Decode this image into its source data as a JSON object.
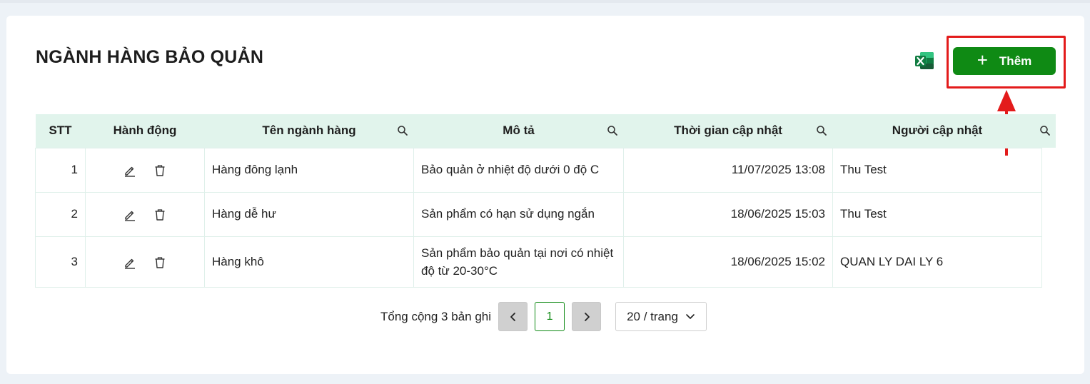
{
  "header": {
    "title": "NGÀNH HÀNG BẢO QUẢN",
    "export_icon": "excel-icon",
    "add_label": "Thêm"
  },
  "table": {
    "columns": [
      "STT",
      "Hành động",
      "Tên ngành hàng",
      "Mô tả",
      "Thời gian cập nhật",
      "Người cập nhật"
    ],
    "rows": [
      {
        "stt": "1",
        "name": "Hàng đông lạnh",
        "desc": "Bảo quản ở nhiệt độ dưới 0 độ C",
        "time": "11/07/2025 13:08",
        "user": "Thu Test"
      },
      {
        "stt": "2",
        "name": "Hàng dễ hư",
        "desc": "Sản phẩm có hạn sử dụng ngắn",
        "time": "18/06/2025 15:03",
        "user": "Thu Test"
      },
      {
        "stt": "3",
        "name": "Hàng khô",
        "desc": "Sản phẩm bảo quản tại nơi có nhiệt độ từ 20-30°C",
        "time": "18/06/2025 15:02",
        "user": "QUAN LY DAI LY 6"
      }
    ]
  },
  "pagination": {
    "total_text": "Tổng cộng 3 bản ghi",
    "current_page": "1",
    "per_page": "20 / trang"
  },
  "colors": {
    "accent": "#0f8a14",
    "header_bg": "#e1f4ec",
    "highlight": "#e31b1b"
  }
}
